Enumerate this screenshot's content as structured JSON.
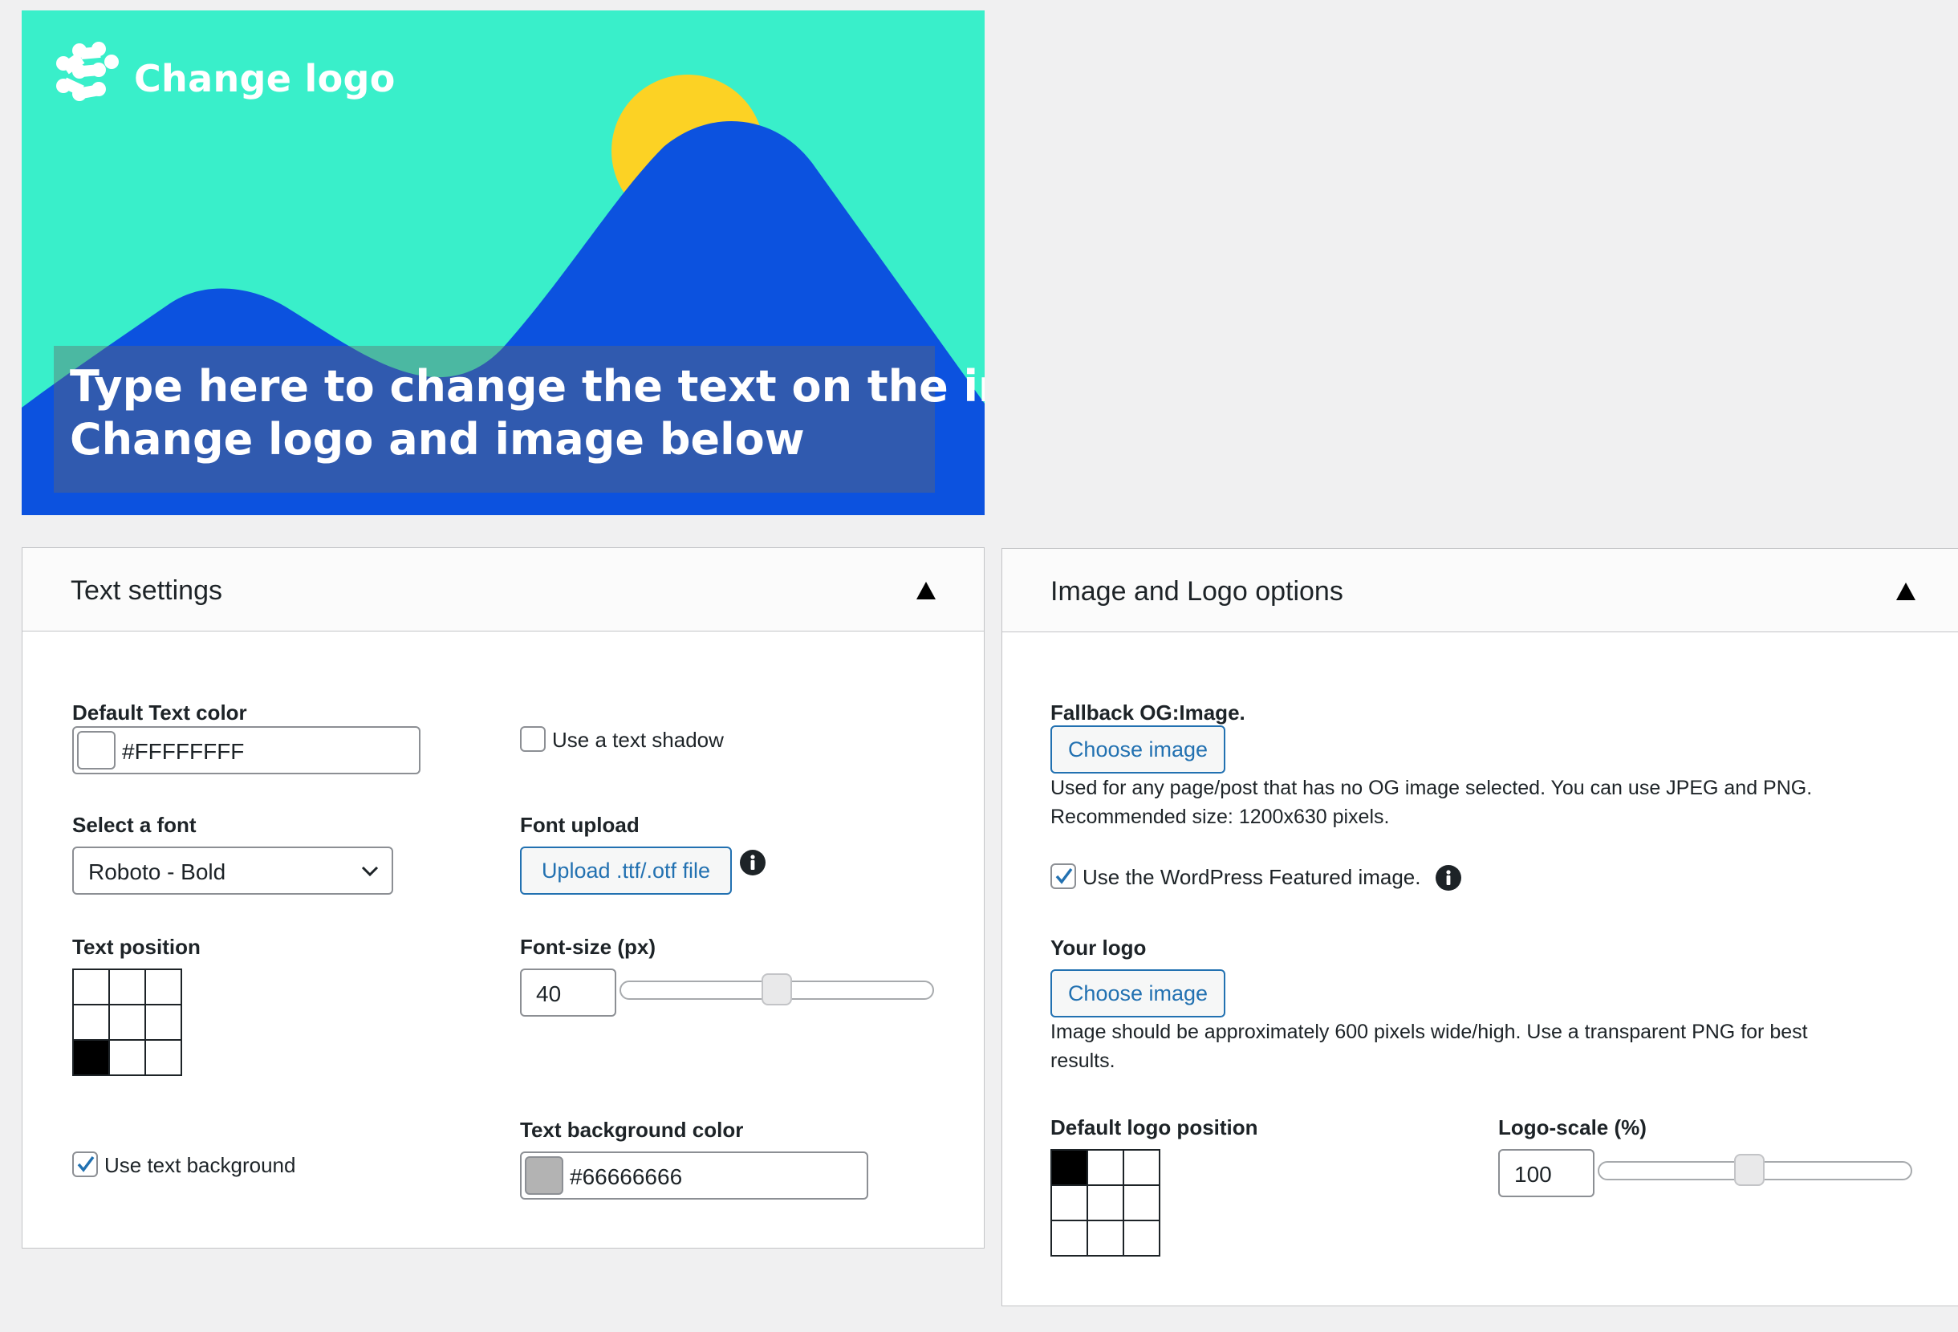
{
  "preview": {
    "logo_text": "Change logo",
    "line1": "Type here to change the text on the image",
    "line2": "Change logo and image below",
    "colors": {
      "sky": "#39efca",
      "sun": "#fcd224",
      "mountain": "#0c52df"
    }
  },
  "text_settings": {
    "title": "Text settings",
    "toggle_icon": "triangle-up-icon",
    "default_text_color_label": "Default Text color",
    "default_text_color_value": "#FFFFFFFF",
    "text_shadow_label": "Use a text shadow",
    "text_shadow_checked": false,
    "select_font_label": "Select a font",
    "select_font_value": "Roboto - Bold",
    "font_upload_label": "Font upload",
    "font_upload_button": "Upload .ttf/.otf file",
    "text_position_label": "Text position",
    "text_position_selected": "bottom-left",
    "font_size_label": "Font-size (px)",
    "font_size_value": "40",
    "font_size_slider_fraction": 0.5,
    "use_text_background_label": "Use text background",
    "use_text_background_checked": true,
    "text_bg_color_label": "Text background color",
    "text_bg_color_value": "#66666666",
    "text_bg_swatch": "#b3b3b3"
  },
  "image_logo": {
    "title": "Image and Logo options",
    "toggle_icon": "triangle-up-icon",
    "fallback_label": "Fallback OG:Image.",
    "choose_image_1": "Choose image",
    "fallback_desc_1": "Used for any page/post that has no OG image selected. You can use JPEG and PNG.",
    "fallback_desc_2": "Recommended size: 1200x630 pixels.",
    "featured_label": "Use the WordPress Featured image.",
    "featured_checked": true,
    "your_logo_label": "Your logo",
    "choose_image_2": "Choose image",
    "logo_desc_1": "Image should be approximately 600 pixels wide/high. Use a transparent PNG for best",
    "logo_desc_2": "results.",
    "logo_position_label": "Default logo position",
    "logo_position_selected": "top-left",
    "logo_scale_label": "Logo-scale (%)",
    "logo_scale_value": "100",
    "logo_scale_slider_fraction": 0.48
  },
  "colors": {
    "accent": "#2271b1",
    "border": "#c3c4c7",
    "background": "#f0f0f1"
  }
}
